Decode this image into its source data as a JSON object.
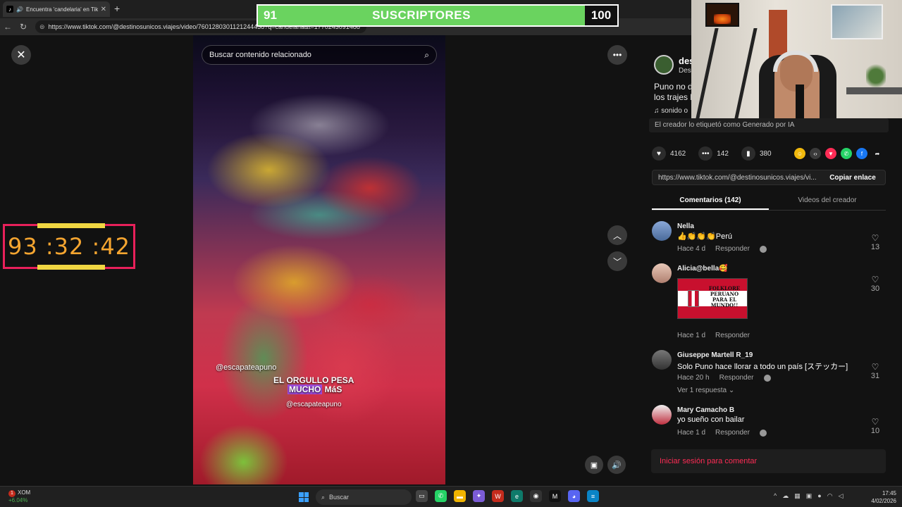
{
  "browser": {
    "tab_title": "Encuentra 'candelaria' en TikTok",
    "tab_icon": "tiktok-icon",
    "url": "https://www.tiktok.com/@destinosunicos.viajes/video/7601280301121244438?q=candelaria&t=1770243091488"
  },
  "overlay": {
    "subs_current": "91",
    "subs_label": "SUSCRIPTORES",
    "subs_goal": "100",
    "subs_progress_fraction": 0.91,
    "timer": "93 :32 :42"
  },
  "video": {
    "search_placeholder": "Buscar contenido relacionado",
    "handle": "@escapateapuno",
    "caption_line1": "EL ORGULLO PESA",
    "caption_line2_highlight": "MUCHO",
    "caption_line2_rest": " MáS",
    "handle2": "@escapateapuno"
  },
  "author": {
    "name": "des",
    "subtitle": "Des",
    "desc_line1": "Puno no du",
    "desc_line2": "los trajes b",
    "sound": "sonido o",
    "ai_label": "El creador lo etiquetó como Generado por IA"
  },
  "stats": {
    "likes": "4162",
    "comments": "142",
    "saves": "380"
  },
  "share": {
    "link": "https://www.tiktok.com/@destinosunicos.viajes/vi...",
    "copy_label": "Copiar enlace"
  },
  "tabs": {
    "comments": "Comentarios (142)",
    "creator_videos": "Videos del creador"
  },
  "comments": [
    {
      "user": "Nella",
      "text": "👍👏👏👏Perú",
      "time": "Hace 4 d",
      "reply": "Responder",
      "likes": "13"
    },
    {
      "user": "Alicia@bella🥰",
      "text": "",
      "sticker_text": "FOLKLORE PERUANO PARA EL MUNDO!!",
      "time": "Hace 1 d",
      "reply": "Responder",
      "likes": "30"
    },
    {
      "user": "Giuseppe Martell R_19",
      "text": "Solo Puno hace llorar a todo un país [ステッカー]",
      "time": "Hace 20 h",
      "reply": "Responder",
      "likes": "31",
      "see_replies": "Ver 1 respuesta ⌄"
    },
    {
      "user": "Mary Camacho B",
      "text": "yo sueño con bailar",
      "time": "Hace 1 d",
      "reply": "Responder",
      "likes": "10"
    }
  ],
  "login_prompt": "Iniciar sesión para comentar",
  "taskbar": {
    "stock_name": "XOM",
    "stock_change": "+6.04%",
    "stock_badge": "1",
    "search": "Buscar",
    "time": "17:45",
    "date": "4/02/2026"
  },
  "colors": {
    "accent": "#fe2c55",
    "progress": "#6ad35f",
    "timer_border": "#e8205a",
    "timer_digits": "#f5a530"
  }
}
